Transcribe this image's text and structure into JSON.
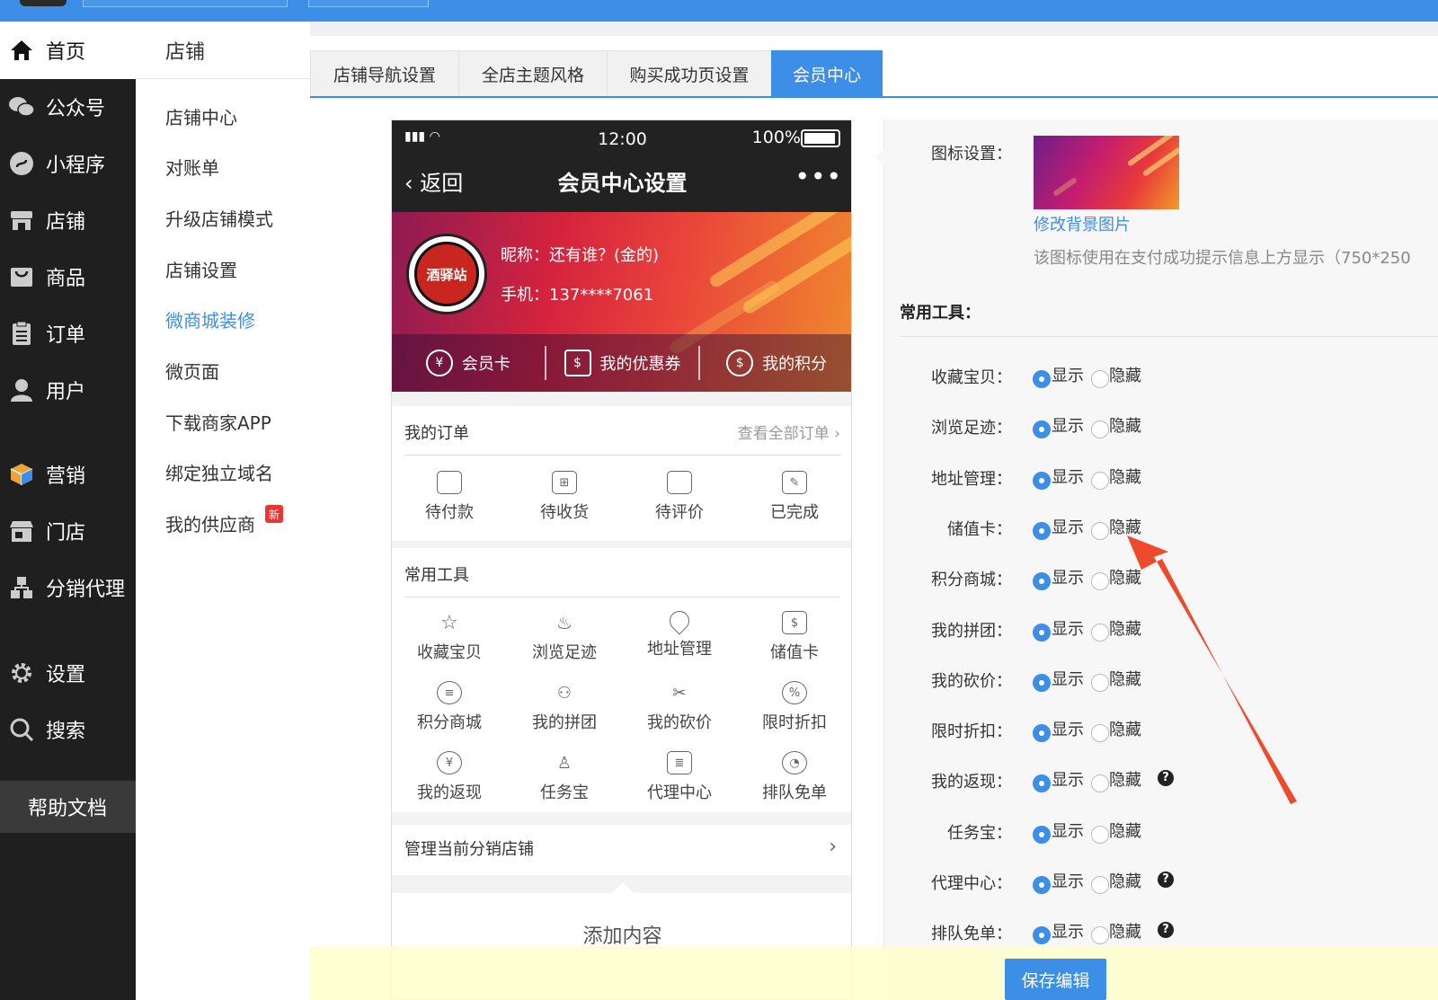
{
  "nav": {
    "items": [
      {
        "label": "首页",
        "icon": "home-icon"
      },
      {
        "label": "公众号",
        "icon": "wechat-icon"
      },
      {
        "label": "小程序",
        "icon": "mini-program-icon"
      },
      {
        "label": "店铺",
        "icon": "store-icon"
      },
      {
        "label": "商品",
        "icon": "goods-icon"
      },
      {
        "label": "订单",
        "icon": "order-icon"
      },
      {
        "label": "用户",
        "icon": "user-icon"
      },
      {
        "label": "营销",
        "icon": "marketing-icon"
      },
      {
        "label": "门店",
        "icon": "shop-icon"
      },
      {
        "label": "分销代理",
        "icon": "distribution-icon"
      },
      {
        "label": "设置",
        "icon": "gear-icon"
      },
      {
        "label": "搜索",
        "icon": "search-icon"
      }
    ],
    "help": "帮助文档"
  },
  "subnav": {
    "title": "店铺",
    "items": [
      "店铺中心",
      "对账单",
      "升级店铺模式",
      "店铺设置",
      "微商城装修",
      "微页面",
      "下载商家APP",
      "绑定独立域名",
      "我的供应商"
    ],
    "active": "微商城装修",
    "new_badge": "新"
  },
  "tabs": [
    "店铺导航设置",
    "全店主题风格",
    "购买成功页设置",
    "会员中心"
  ],
  "phone": {
    "time": "12:00",
    "battery": "100%",
    "back": "返回",
    "title": "会员中心设置",
    "more": "•••",
    "avatar_text": "酒驿站",
    "nickname": "昵称：还有谁？(金的)",
    "mobile": "手机：137****7061",
    "bar": [
      "会员卡",
      "我的优惠券",
      "我的积分"
    ],
    "orders_title": "我的订单",
    "orders_all": "查看全部订单",
    "orders": [
      "待付款",
      "待收货",
      "待评价",
      "已完成"
    ],
    "tools_title": "常用工具",
    "tools": [
      "收藏宝贝",
      "浏览足迹",
      "地址管理",
      "储值卡",
      "积分商城",
      "我的拼团",
      "我的砍价",
      "限时折扣",
      "我的返现",
      "任务宝",
      "代理中心",
      "排队免单"
    ],
    "manage": "管理当前分销店铺",
    "add": "添加内容"
  },
  "settings": {
    "icon_label": "图标设置：",
    "change_bg": "修改背景图片",
    "hint": "该图标使用在支付成功提示信息上方显示（750*250",
    "tools_head": "常用工具：",
    "show": "显示",
    "hide": "隐藏",
    "rows": [
      {
        "label": "收藏宝贝：",
        "help": false
      },
      {
        "label": "浏览足迹：",
        "help": false
      },
      {
        "label": "地址管理：",
        "help": false
      },
      {
        "label": "储值卡：",
        "help": false
      },
      {
        "label": "积分商城：",
        "help": false
      },
      {
        "label": "我的拼团：",
        "help": false
      },
      {
        "label": "我的砍价：",
        "help": false
      },
      {
        "label": "限时折扣：",
        "help": false
      },
      {
        "label": "我的返现：",
        "help": true
      },
      {
        "label": "任务宝：",
        "help": false
      },
      {
        "label": "代理中心：",
        "help": true
      },
      {
        "label": "排队免单：",
        "help": true
      }
    ]
  },
  "save": "保存编辑",
  "colors": {
    "accent": "#3d8ee6",
    "sidebar": "#1f1f1f",
    "arrow": "#f04a2c"
  }
}
